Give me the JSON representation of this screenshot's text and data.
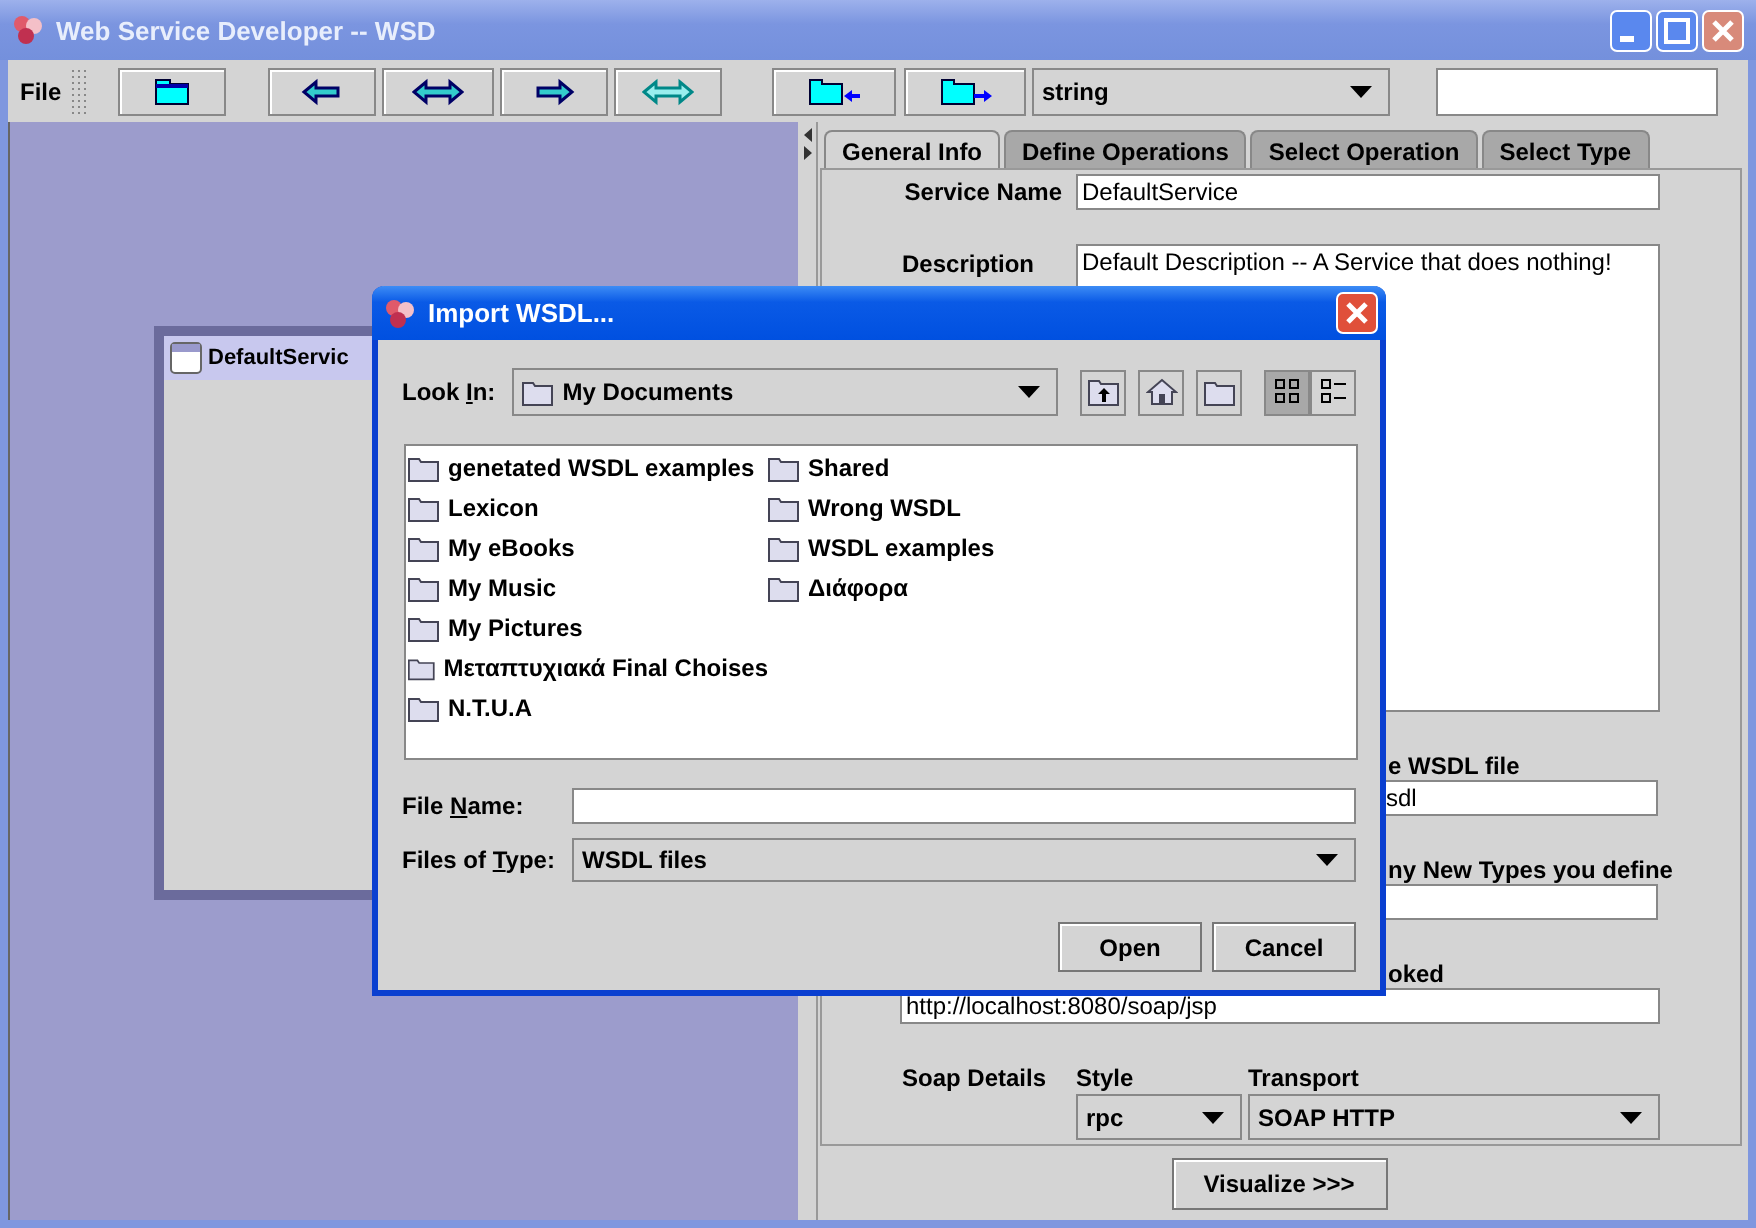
{
  "window": {
    "title": "Web Service Developer -- WSD"
  },
  "menu": [
    {
      "label": "File"
    }
  ],
  "toolbar": {
    "buttons": [
      {
        "kind": "folder"
      },
      {
        "kind": "arrow-left"
      },
      {
        "kind": "arrow-both"
      },
      {
        "kind": "arrow-right"
      },
      {
        "kind": "arrow-both-light"
      },
      {
        "kind": "folder-in"
      },
      {
        "kind": "folder-out"
      }
    ],
    "type_combo": {
      "value": "string"
    }
  },
  "canvas": {
    "frame_title": "DefaultServic"
  },
  "tabs": [
    {
      "label": "General Info",
      "selected": true
    },
    {
      "label": "Define Operations",
      "selected": false
    },
    {
      "label": "Select Operation",
      "selected": false
    },
    {
      "label": "Select Type",
      "selected": false
    }
  ],
  "form": {
    "service_name": {
      "label": "Service Name",
      "value": "DefaultService"
    },
    "description": {
      "label": "Description",
      "value": "Default Description -- A Service that does nothing!"
    },
    "wsdl": {
      "label": "e WSDL file",
      "value": "sdl"
    },
    "types": {
      "label": "ny New Types you define"
    },
    "endpoint": {
      "label": "oked",
      "value": "http://localhost:8080/soap/jsp"
    },
    "soap": {
      "label": "Soap Details",
      "style_label": "Style",
      "style": "rpc",
      "transport_label": "Transport",
      "transport": "SOAP HTTP"
    },
    "visualize": "Visualize >>>"
  },
  "dialog": {
    "title": "Import WSDL...",
    "look_in": {
      "label": {
        "before": "Look ",
        "key": "I",
        "after": "n:"
      },
      "value": "My Documents"
    },
    "tools": [
      {
        "kind": "up"
      },
      {
        "kind": "home"
      },
      {
        "kind": "new-folder"
      }
    ],
    "views": [
      {
        "kind": "list",
        "selected": true
      },
      {
        "kind": "details",
        "selected": false
      }
    ],
    "files": [
      "genetated WSDL examples",
      "Lexicon",
      "My eBooks",
      "My Music",
      "My Pictures",
      "Μεταπτυχιακά Final Choises",
      "N.T.U.A",
      "Shared",
      "Wrong WSDL",
      "WSDL examples",
      "Διάφορα"
    ],
    "file_name": {
      "label": {
        "before": "File ",
        "key": "N",
        "after": "ame:"
      }
    },
    "file_type": {
      "label": {
        "before": "Files of ",
        "key": "T",
        "after": "ype:"
      },
      "value": "WSDL files"
    },
    "buttons": [
      "Open",
      "Cancel"
    ]
  }
}
